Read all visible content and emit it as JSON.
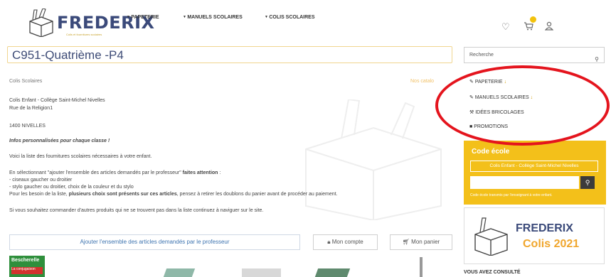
{
  "header": {
    "logo_text": "FREDERIX",
    "logo_tagline": "Colis et fournitures scolaires",
    "nav": [
      "PAPETERIE",
      "MANUELS SCOLAIRES",
      "COLIS SCOLAIRES"
    ],
    "icons": [
      "heart-icon",
      "cart-icon",
      "user-icon"
    ]
  },
  "page": {
    "title": "C951-Quatrième -P4",
    "breadcrumb": "Colis Scolaires",
    "catalog_link": "Nos catalo",
    "school_name": "Colis Enfant - Collège Saint-Michel Nivelles",
    "street": "Rue de la Religion1",
    "city": "1400 NIVELLES",
    "headline": "Infos personnalisées pour chaque classe !",
    "intro": "Voici la liste des fournitures scolaires nécessaires à votre enfant.",
    "select_text_pre": "En sélectionnant \"ajouter l'ensemble des articles demandés par le professeur\"",
    "select_text_bold": "faites attention",
    "select_text_post": ":",
    "bullet1": "- ciseaux gaucher ou droitier",
    "bullet2": "- stylo gaucher ou droitier, choix de la couleur et du stylo",
    "needs_pre": "Pour les besoin de la liste,",
    "needs_bold": "plusieurs choix sont présents sur ces articles",
    "needs_post": ", pensez à retirer les doublons du panier avant de procéder au paiement.",
    "other_products": "Si vous souhaitez commander d'autres produits qui ne se trouvent pas dans la liste continuez à naviguer sur le site."
  },
  "buttons": {
    "add_all": "Ajouter l'ensemble des articles demandés par le professeur",
    "account": "Mon compte",
    "cart": "Mon panier"
  },
  "sidebar": {
    "search_placeholder": "Recherche",
    "menu": [
      {
        "label": "PAPETERIE",
        "suffix": "↓",
        "icon": "edit-icon"
      },
      {
        "label": "MANUELS SCOLAIRES",
        "suffix": "↓",
        "icon": "edit-icon"
      },
      {
        "label": "IDÉES BRICOLAGES",
        "suffix": "",
        "icon": "tools-icon"
      },
      {
        "label": "PROMOTIONS",
        "suffix": "",
        "icon": "bookmark-icon"
      }
    ],
    "code_title": "Code école",
    "code_school": "Colis Enfant - Collège Saint-Michel Nivelles",
    "code_note": "Code école transmis par l'enseignant à votre enfant.",
    "promo_brand": "FREDERIX",
    "promo_sub": "Colis 2021",
    "recently_viewed": "VOUS AVEZ CONSULTÉ"
  },
  "products": {
    "first_label1": "Bescherelle",
    "first_label2": "La conjugaison"
  },
  "colors": {
    "accent": "#f3c01a",
    "brand": "#3b4a7a",
    "annotation": "#e4141d"
  }
}
